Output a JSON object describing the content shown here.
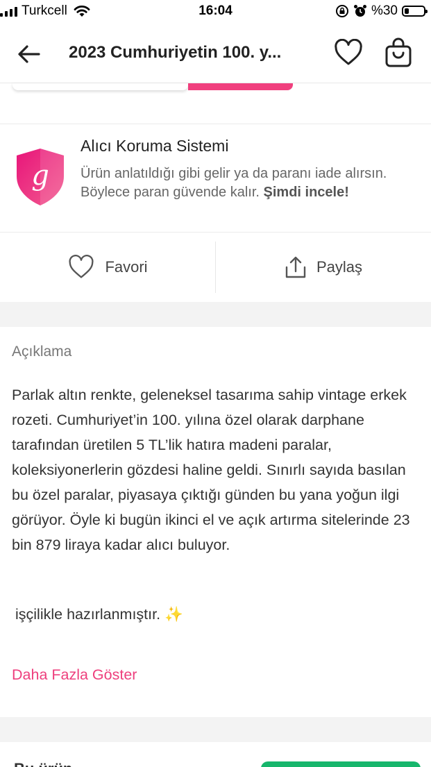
{
  "status_bar": {
    "carrier": "Turkcell",
    "time": "16:04",
    "battery": "%30",
    "battery_level": 0.3
  },
  "nav": {
    "title": "2023 Cumhuriyetin 100. y...",
    "back_icon": "arrow-left-icon",
    "favorite_icon": "heart-icon",
    "cart_icon": "shopping-bag-icon"
  },
  "protection": {
    "title": "Alıcı Koruma Sistemi",
    "text": "Ürün anlatıldığı gibi gelir ya da paranı iade alırsın. Böylece paran güvende kalır. ",
    "link": "Şimdi incele!",
    "logo_letter": "g"
  },
  "actions": {
    "favorite": "Favori",
    "share": "Paylaş"
  },
  "description": {
    "heading": "Açıklama",
    "body": "Parlak altın renkte, geleneksel tasarıma sahip vintage erkek rozeti. Cumhuriyet’in 100. yılına özel olarak darphane tarafından üretilen 5 TL’lik hatıra madeni paralar, koleksiyonerlerin gözdesi haline geldi. Sınırlı sayıda basılan bu özel paralar, piyasaya çıktığı günden bu yana yoğun ilgi görüyor. Öyle ki bugün ikinci el ve açık artırma sitelerinde 23 bin 879 liraya kadar alıcı buluyor.",
    "extra": "işçilikle hazırlanmıştır. ✨",
    "show_more": "Daha Fazla Göster"
  },
  "next_section": {
    "title": "Bu ürün ..."
  },
  "colors": {
    "accent": "#ee3f7d",
    "green": "#17b66c"
  }
}
